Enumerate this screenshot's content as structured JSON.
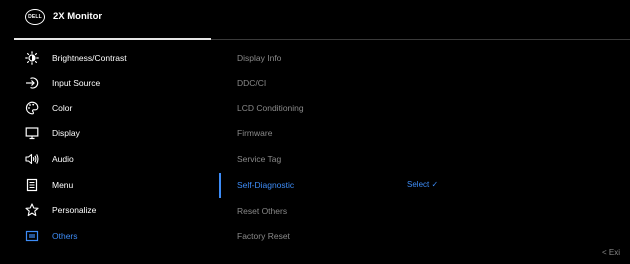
{
  "header": {
    "logo_text": "DELL",
    "title": "2X Monitor"
  },
  "menu": {
    "items": [
      {
        "label": "Brightness/Contrast",
        "icon": "brightness-icon"
      },
      {
        "label": "Input Source",
        "icon": "input-source-icon"
      },
      {
        "label": "Color",
        "icon": "color-palette-icon"
      },
      {
        "label": "Display",
        "icon": "display-icon"
      },
      {
        "label": "Audio",
        "icon": "audio-icon"
      },
      {
        "label": "Menu",
        "icon": "menu-icon"
      },
      {
        "label": "Personalize",
        "icon": "star-icon"
      },
      {
        "label": "Others",
        "icon": "others-icon",
        "selected": true
      }
    ]
  },
  "submenu": {
    "items": [
      {
        "label": "Display Info"
      },
      {
        "label": "DDC/CI"
      },
      {
        "label": "LCD Conditioning"
      },
      {
        "label": "Firmware"
      },
      {
        "label": "Service Tag"
      },
      {
        "label": "Self-Diagnostic",
        "selected": true
      },
      {
        "label": "Reset Others"
      },
      {
        "label": "Factory Reset"
      }
    ],
    "action_label": "Select ✓"
  },
  "footer": {
    "exit_label": "<  Exi"
  },
  "colors": {
    "background": "#000000",
    "accent": "#3d8cf7",
    "text": "#ffffff",
    "dim_text": "#8a8a8a"
  }
}
